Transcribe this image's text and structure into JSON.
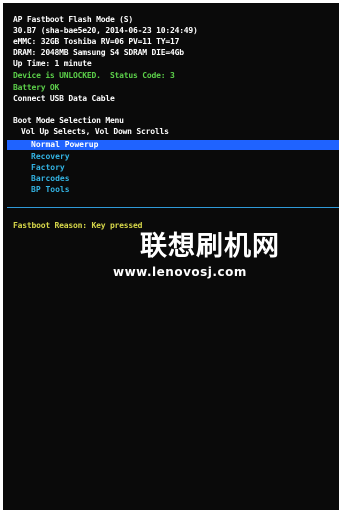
{
  "header": {
    "line1": "AP Fastboot Flash Mode (S)",
    "line2": "30.B7 (sha-bae5e20, 2014-06-23 10:24:49)",
    "line3": "eMMC: 32GB Toshiba RV=06 PV=11 TY=17",
    "line4": "DRAM: 2048MB Samsung S4 SDRAM DIE=4Gb",
    "line5": "Up Time: 1 minute",
    "line6": "Device is UNLOCKED.  Status Code: 3",
    "line7": "Battery OK",
    "line8": "Connect USB Data Cable"
  },
  "boot_menu": {
    "title": "Boot Mode Selection Menu",
    "instructions": "Vol Up Selects, Vol Down Scrolls",
    "items": [
      "Normal Powerup",
      "Recovery",
      "Factory",
      "Barcodes",
      "BP Tools"
    ],
    "selected_index": 0
  },
  "fastboot_reason": "Fastboot Reason: Key pressed",
  "watermark": {
    "site_name": "联想刷机网",
    "url": "www.lenovosj.com"
  },
  "colors": {
    "background": "#0a0a0a",
    "text": "#ffffff",
    "status_ok": "#5cd04a",
    "reason": "#d8d84a",
    "menu_item": "#33b5e5",
    "highlight": "#1f63ff",
    "divider": "#2f9ad8"
  }
}
